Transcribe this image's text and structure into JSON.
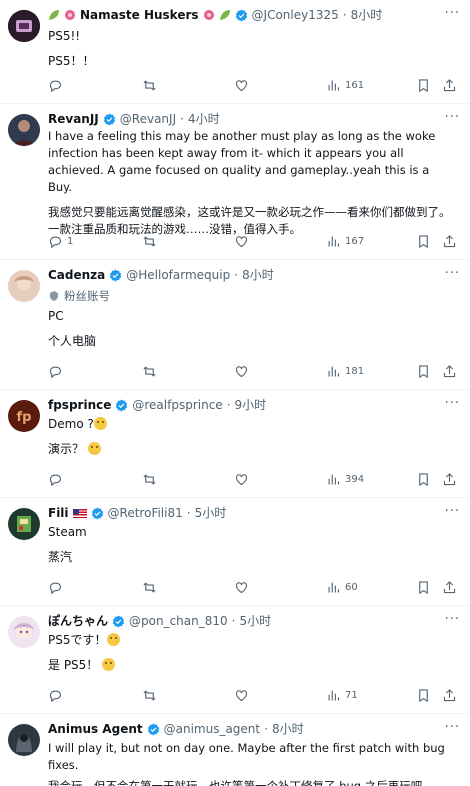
{
  "posts": [
    {
      "name": "Namaste Huskers",
      "handle": "@JConley1325",
      "time": "8小时",
      "lines": [
        "PS5!!",
        "PS5！！"
      ],
      "views": "161",
      "replies": "",
      "avatar_color": "#2b1a2a"
    },
    {
      "name": "RevanJJ",
      "handle": "@RevanJJ",
      "time": "4小时",
      "lines": [
        "I have a feeling this may be another must play as long as the woke infection has been kept away from it- which it appears you all achieved. A game focused on quality and gameplay..yeah this is a Buy.",
        "我感觉只要能远离觉醒感染，这或许是又一款必玩之作——看来你们都做到了。一款注重品质和玩法的游戏……没错，值得入手。"
      ],
      "views": "167",
      "replies": "1",
      "avatar_color": "#2e3a4e"
    },
    {
      "name": "Cadenza",
      "handle": "@Hellofarmequip",
      "time": "8小时",
      "subscriber_label": "粉丝账号",
      "lines": [
        "PC",
        "个人电脑"
      ],
      "views": "181",
      "replies": "",
      "avatar_color": "#d9b9a8"
    },
    {
      "name": "fpsprince",
      "handle": "@realfpsprince",
      "time": "9小时",
      "lines": [
        "Demo ?",
        "演示？"
      ],
      "views": "394",
      "replies": "",
      "avatar_color": "#7a2a14"
    },
    {
      "name": "Fili",
      "handle": "@RetroFili81",
      "time": "5小时",
      "lines": [
        "Steam",
        "蒸汽"
      ],
      "views": "60",
      "replies": "",
      "avatar_color": "#1f3a2a"
    },
    {
      "name": "ぽんちゃん",
      "handle": "@pon_chan_810",
      "time": "5小时",
      "lines": [
        "PS5です！",
        "是 PS5！"
      ],
      "views": "71",
      "replies": "",
      "avatar_color": "#e8d4e8"
    },
    {
      "name": "Animus Agent",
      "handle": "@animus_agent",
      "time": "8小时",
      "lines": [
        "I will play it, but not on day one. Maybe after the first patch with bug fixes.",
        "我会玩，但不会在第一天就玩。也许等第一个补丁修复了 bug 之后再玩吧。"
      ],
      "views": "",
      "replies": "",
      "avatar_color": "#3a4450"
    }
  ],
  "colors": {
    "verified": "#1d9bf0",
    "muted": "#536471"
  }
}
